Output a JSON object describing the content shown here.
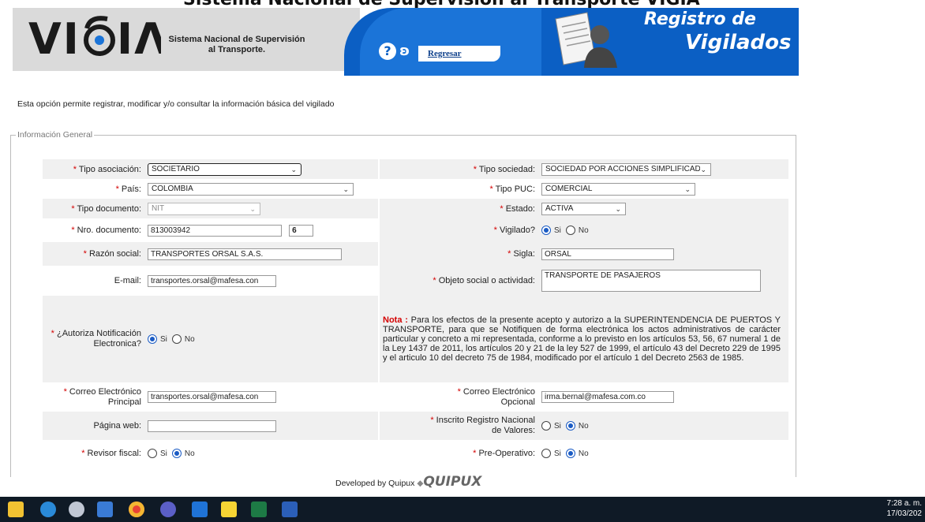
{
  "page_title": "Sistema Nacional de Supervisión al Transporte VIGIA",
  "header": {
    "logo_text": "VIGIA",
    "logo_sub": "Sistema Nacional de Supervisión al Transporte.",
    "help_icon": "question-circle-icon",
    "back_icon": "vigia-swirl-icon",
    "back_label": "Regresar",
    "title_line1": "Registro de",
    "title_line2": "Vigilados",
    "colors": {
      "blue": "#0b5fc4",
      "grey": "#dadada"
    }
  },
  "intro_text": "Esta opción permite registrar, modificar y/o consultar la información básica del vigilado",
  "section_legend": "Información General",
  "form": {
    "tipo_asociacion": {
      "label": "Tipo asociación:",
      "value": "SOCIETARIO"
    },
    "tipo_sociedad": {
      "label": "Tipo sociedad:",
      "value": "SOCIEDAD POR ACCIONES SIMPLIFICAD"
    },
    "pais": {
      "label": "País:",
      "value": "COLOMBIA"
    },
    "tipo_puc": {
      "label": "Tipo PUC:",
      "value": "COMERCIAL"
    },
    "tipo_documento": {
      "label": "Tipo documento:",
      "value": "NIT"
    },
    "estado": {
      "label": "Estado:",
      "value": "ACTIVA"
    },
    "nro_documento": {
      "label": "Nro. documento:",
      "value": "813003942",
      "dv": "6"
    },
    "vigilado": {
      "label": "Vigilado?",
      "yes": "Si",
      "no": "No",
      "selected": "Si"
    },
    "razon_social": {
      "label": "Razón social:",
      "value": "TRANSPORTES ORSAL S.A.S."
    },
    "sigla": {
      "label": "Sigla:",
      "value": "ORSAL"
    },
    "email": {
      "label": "E-mail:",
      "value": "transportes.orsal@mafesa.con"
    },
    "objeto_social": {
      "label": "Objeto social o actividad:",
      "value": "TRANSPORTE DE PASAJEROS"
    },
    "autoriza": {
      "label_1": "¿Autoriza Notificación",
      "label_2": "Electronica?",
      "yes": "Si",
      "no": "No",
      "selected": "Si"
    },
    "nota_title": "Nota :",
    "nota_text": "Para los efectos de la presente acepto y autorizo a la SUPERINTENDENCIA DE PUERTOS Y TRANSPORTE, para que se Notifiquen de forma electrónica los actos administrativos de carácter particular y concreto a mi representada, conforme a lo previsto en los artículos 53, 56, 67 numeral 1 de la Ley 1437 de 2011, los artículos 20 y 21 de la ley 527 de 1999, el artículo 43 del Decreto 229 de 1995 y el articulo 10 del decreto 75 de 1984, modificado por el artículo 1 del Decreto 2563 de 1985.",
    "correo_principal": {
      "label_1": "Correo Electrónico",
      "label_2": "Principal",
      "value": "transportes.orsal@mafesa.con"
    },
    "correo_opcional": {
      "label_1": "Correo Electrónico",
      "label_2": "Opcional",
      "value": "irma.bernal@mafesa.com.co"
    },
    "pagina_web": {
      "label": "Página web:",
      "value": ""
    },
    "inscrito": {
      "label_1": "Inscrito Registro Nacional",
      "label_2": "de Valores:",
      "yes": "Si",
      "no": "No",
      "selected": "No"
    },
    "revisor": {
      "label": "Revisor fiscal:",
      "yes": "Si",
      "no": "No",
      "selected": "No"
    },
    "preoperativo": {
      "label": "Pre-Operativo:",
      "yes": "Si",
      "no": "No",
      "selected": "No"
    },
    "required_mark": "*"
  },
  "footer": {
    "text": "Developed by Quipux",
    "brand": "QUIPUX"
  },
  "taskbar": {
    "icons": [
      "file-explorer-icon",
      "edge-icon",
      "paint-icon",
      "store-icon",
      "chrome-icon",
      "teams-icon",
      "outlook-icon",
      "sticky-notes-icon",
      "excel-icon",
      "word-icon"
    ],
    "time": "7:28 a. m.",
    "date": "17/03/202"
  }
}
